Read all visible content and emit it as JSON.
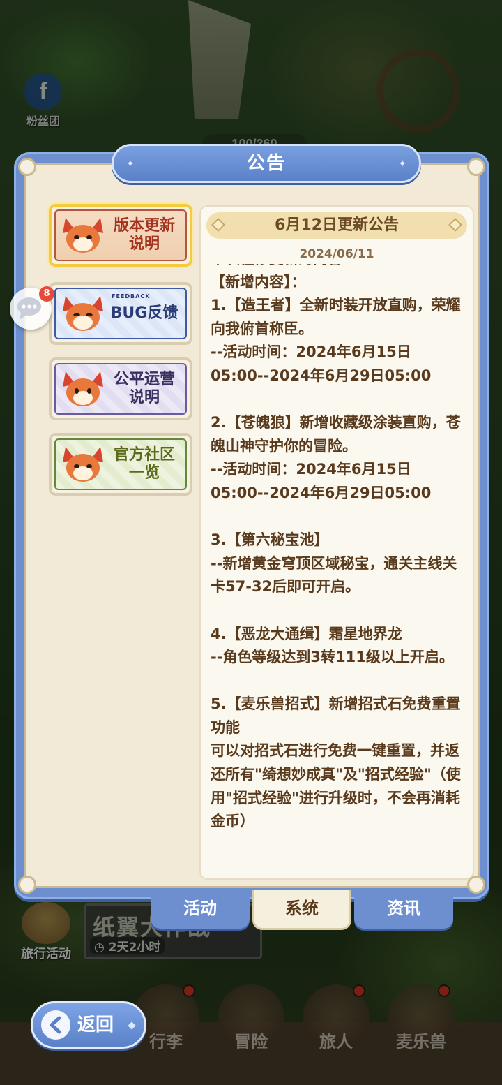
{
  "background": {
    "fan_group_label": "粉丝团",
    "fan_group_icon": "facebook-icon",
    "counter_text": "100/360",
    "travel_event_label": "旅行活动",
    "paper_event_title": "纸翼大作战",
    "paper_event_time": "2天2小时",
    "bottom_nav": [
      {
        "label": "行李",
        "icon": "backpack-icon"
      },
      {
        "label": "冒险",
        "icon": "crossed-swords-icon"
      },
      {
        "label": "旅人",
        "icon": "traveler-icon"
      },
      {
        "label": "麦乐兽",
        "icon": "pet-icon"
      }
    ]
  },
  "panel": {
    "title": "公告",
    "categories": [
      {
        "label": "版本更新\n说明",
        "active": true,
        "theme": "red"
      },
      {
        "label": "BUG反馈",
        "sub": "FEEDBACK",
        "active": false,
        "theme": "blue"
      },
      {
        "label": "公平运营\n说明",
        "active": false,
        "theme": "purple"
      },
      {
        "label": "官方社区\n一览",
        "active": false,
        "theme": "green"
      }
    ],
    "content": {
      "title": "6月12日更新公告",
      "date": "2024/06/11",
      "partial_first_line": "本次在修复新的内容：",
      "body": "【新增内容】：\n1.【造王者】全新时装开放直购，荣耀向我俯首称臣。\n--活动时间：2024年6月15日\n05:00--2024年6月29日05:00\n\n2.【苍魄狼】新增收藏级涂装直购，苍魄山神守护你的冒险。\n--活动时间：2024年6月15日\n05:00--2024年6月29日05:00\n\n3.【第六秘宝池】\n--新增黄金穹顶区域秘宝，通关主线关卡57-32后即可开启。\n\n4.【恶龙大通缉】霜星地界龙\n--角色等级达到3转111级以上开启。\n\n5.【麦乐兽招式】新增招式石免费重置功能\n可以对招式石进行免费一键重置，并返还所有\"绮想妙成真\"及\"招式经验\"（使用\"招式经验\"进行升级时，不会再消耗金币）"
    },
    "tabs": [
      {
        "label": "活动",
        "active": false
      },
      {
        "label": "系统",
        "active": true
      },
      {
        "label": "资讯",
        "active": false
      }
    ]
  },
  "chat": {
    "badge": "8",
    "icon": "chat-bubble-icon"
  },
  "back_button": {
    "label": "返回",
    "icon": "back-arrow-icon"
  },
  "colors": {
    "panel_blue": "#6d8fd0",
    "panel_cream": "#f2ead6",
    "text_brown": "#5a3a1c",
    "active_gold": "#f4cb3e"
  }
}
